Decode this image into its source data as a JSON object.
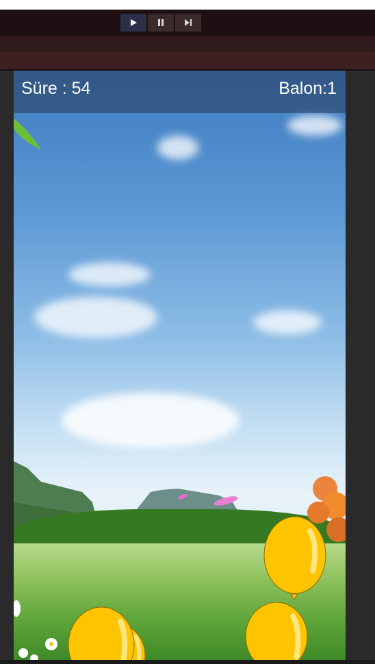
{
  "toolbar": {
    "buttons": [
      {
        "name": "play",
        "icon": "play-icon",
        "active": true
      },
      {
        "name": "pause",
        "icon": "pause-icon",
        "active": false
      },
      {
        "name": "step",
        "icon": "step-forward-icon",
        "active": false
      }
    ]
  },
  "hud": {
    "time_text": "Süre : 54",
    "balloon_text": "Balon:1"
  },
  "colors": {
    "balloon": "#ffc400",
    "balloon_outline": "#8a6a00",
    "hud_text": "#ffffff",
    "toolbar_bg": "#1e1012"
  },
  "balloons": [
    {
      "id": "balloon-1",
      "color": "yellow"
    },
    {
      "id": "balloon-2",
      "color": "yellow"
    },
    {
      "id": "balloon-3",
      "color": "yellow"
    },
    {
      "id": "balloon-4",
      "color": "yellow"
    }
  ]
}
